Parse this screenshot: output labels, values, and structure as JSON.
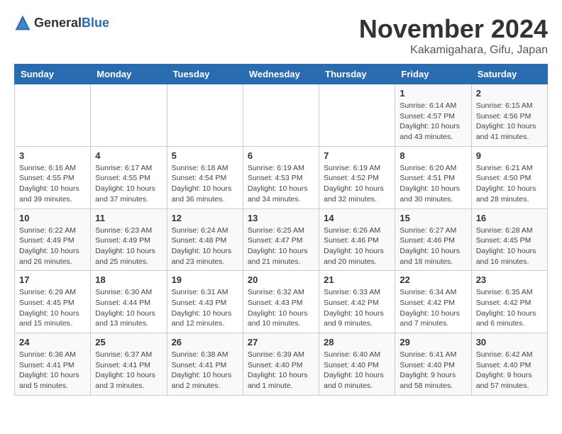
{
  "header": {
    "logo_general": "General",
    "logo_blue": "Blue",
    "month": "November 2024",
    "location": "Kakamigahara, Gifu, Japan"
  },
  "weekdays": [
    "Sunday",
    "Monday",
    "Tuesday",
    "Wednesday",
    "Thursday",
    "Friday",
    "Saturday"
  ],
  "weeks": [
    [
      {
        "day": "",
        "info": ""
      },
      {
        "day": "",
        "info": ""
      },
      {
        "day": "",
        "info": ""
      },
      {
        "day": "",
        "info": ""
      },
      {
        "day": "",
        "info": ""
      },
      {
        "day": "1",
        "info": "Sunrise: 6:14 AM\nSunset: 4:57 PM\nDaylight: 10 hours\nand 43 minutes."
      },
      {
        "day": "2",
        "info": "Sunrise: 6:15 AM\nSunset: 4:56 PM\nDaylight: 10 hours\nand 41 minutes."
      }
    ],
    [
      {
        "day": "3",
        "info": "Sunrise: 6:16 AM\nSunset: 4:55 PM\nDaylight: 10 hours\nand 39 minutes."
      },
      {
        "day": "4",
        "info": "Sunrise: 6:17 AM\nSunset: 4:55 PM\nDaylight: 10 hours\nand 37 minutes."
      },
      {
        "day": "5",
        "info": "Sunrise: 6:18 AM\nSunset: 4:54 PM\nDaylight: 10 hours\nand 36 minutes."
      },
      {
        "day": "6",
        "info": "Sunrise: 6:19 AM\nSunset: 4:53 PM\nDaylight: 10 hours\nand 34 minutes."
      },
      {
        "day": "7",
        "info": "Sunrise: 6:19 AM\nSunset: 4:52 PM\nDaylight: 10 hours\nand 32 minutes."
      },
      {
        "day": "8",
        "info": "Sunrise: 6:20 AM\nSunset: 4:51 PM\nDaylight: 10 hours\nand 30 minutes."
      },
      {
        "day": "9",
        "info": "Sunrise: 6:21 AM\nSunset: 4:50 PM\nDaylight: 10 hours\nand 28 minutes."
      }
    ],
    [
      {
        "day": "10",
        "info": "Sunrise: 6:22 AM\nSunset: 4:49 PM\nDaylight: 10 hours\nand 26 minutes."
      },
      {
        "day": "11",
        "info": "Sunrise: 6:23 AM\nSunset: 4:49 PM\nDaylight: 10 hours\nand 25 minutes."
      },
      {
        "day": "12",
        "info": "Sunrise: 6:24 AM\nSunset: 4:48 PM\nDaylight: 10 hours\nand 23 minutes."
      },
      {
        "day": "13",
        "info": "Sunrise: 6:25 AM\nSunset: 4:47 PM\nDaylight: 10 hours\nand 21 minutes."
      },
      {
        "day": "14",
        "info": "Sunrise: 6:26 AM\nSunset: 4:46 PM\nDaylight: 10 hours\nand 20 minutes."
      },
      {
        "day": "15",
        "info": "Sunrise: 6:27 AM\nSunset: 4:46 PM\nDaylight: 10 hours\nand 18 minutes."
      },
      {
        "day": "16",
        "info": "Sunrise: 6:28 AM\nSunset: 4:45 PM\nDaylight: 10 hours\nand 16 minutes."
      }
    ],
    [
      {
        "day": "17",
        "info": "Sunrise: 6:29 AM\nSunset: 4:45 PM\nDaylight: 10 hours\nand 15 minutes."
      },
      {
        "day": "18",
        "info": "Sunrise: 6:30 AM\nSunset: 4:44 PM\nDaylight: 10 hours\nand 13 minutes."
      },
      {
        "day": "19",
        "info": "Sunrise: 6:31 AM\nSunset: 4:43 PM\nDaylight: 10 hours\nand 12 minutes."
      },
      {
        "day": "20",
        "info": "Sunrise: 6:32 AM\nSunset: 4:43 PM\nDaylight: 10 hours\nand 10 minutes."
      },
      {
        "day": "21",
        "info": "Sunrise: 6:33 AM\nSunset: 4:42 PM\nDaylight: 10 hours\nand 9 minutes."
      },
      {
        "day": "22",
        "info": "Sunrise: 6:34 AM\nSunset: 4:42 PM\nDaylight: 10 hours\nand 7 minutes."
      },
      {
        "day": "23",
        "info": "Sunrise: 6:35 AM\nSunset: 4:42 PM\nDaylight: 10 hours\nand 6 minutes."
      }
    ],
    [
      {
        "day": "24",
        "info": "Sunrise: 6:36 AM\nSunset: 4:41 PM\nDaylight: 10 hours\nand 5 minutes."
      },
      {
        "day": "25",
        "info": "Sunrise: 6:37 AM\nSunset: 4:41 PM\nDaylight: 10 hours\nand 3 minutes."
      },
      {
        "day": "26",
        "info": "Sunrise: 6:38 AM\nSunset: 4:41 PM\nDaylight: 10 hours\nand 2 minutes."
      },
      {
        "day": "27",
        "info": "Sunrise: 6:39 AM\nSunset: 4:40 PM\nDaylight: 10 hours\nand 1 minute."
      },
      {
        "day": "28",
        "info": "Sunrise: 6:40 AM\nSunset: 4:40 PM\nDaylight: 10 hours\nand 0 minutes."
      },
      {
        "day": "29",
        "info": "Sunrise: 6:41 AM\nSunset: 4:40 PM\nDaylight: 9 hours\nand 58 minutes."
      },
      {
        "day": "30",
        "info": "Sunrise: 6:42 AM\nSunset: 4:40 PM\nDaylight: 9 hours\nand 57 minutes."
      }
    ]
  ]
}
